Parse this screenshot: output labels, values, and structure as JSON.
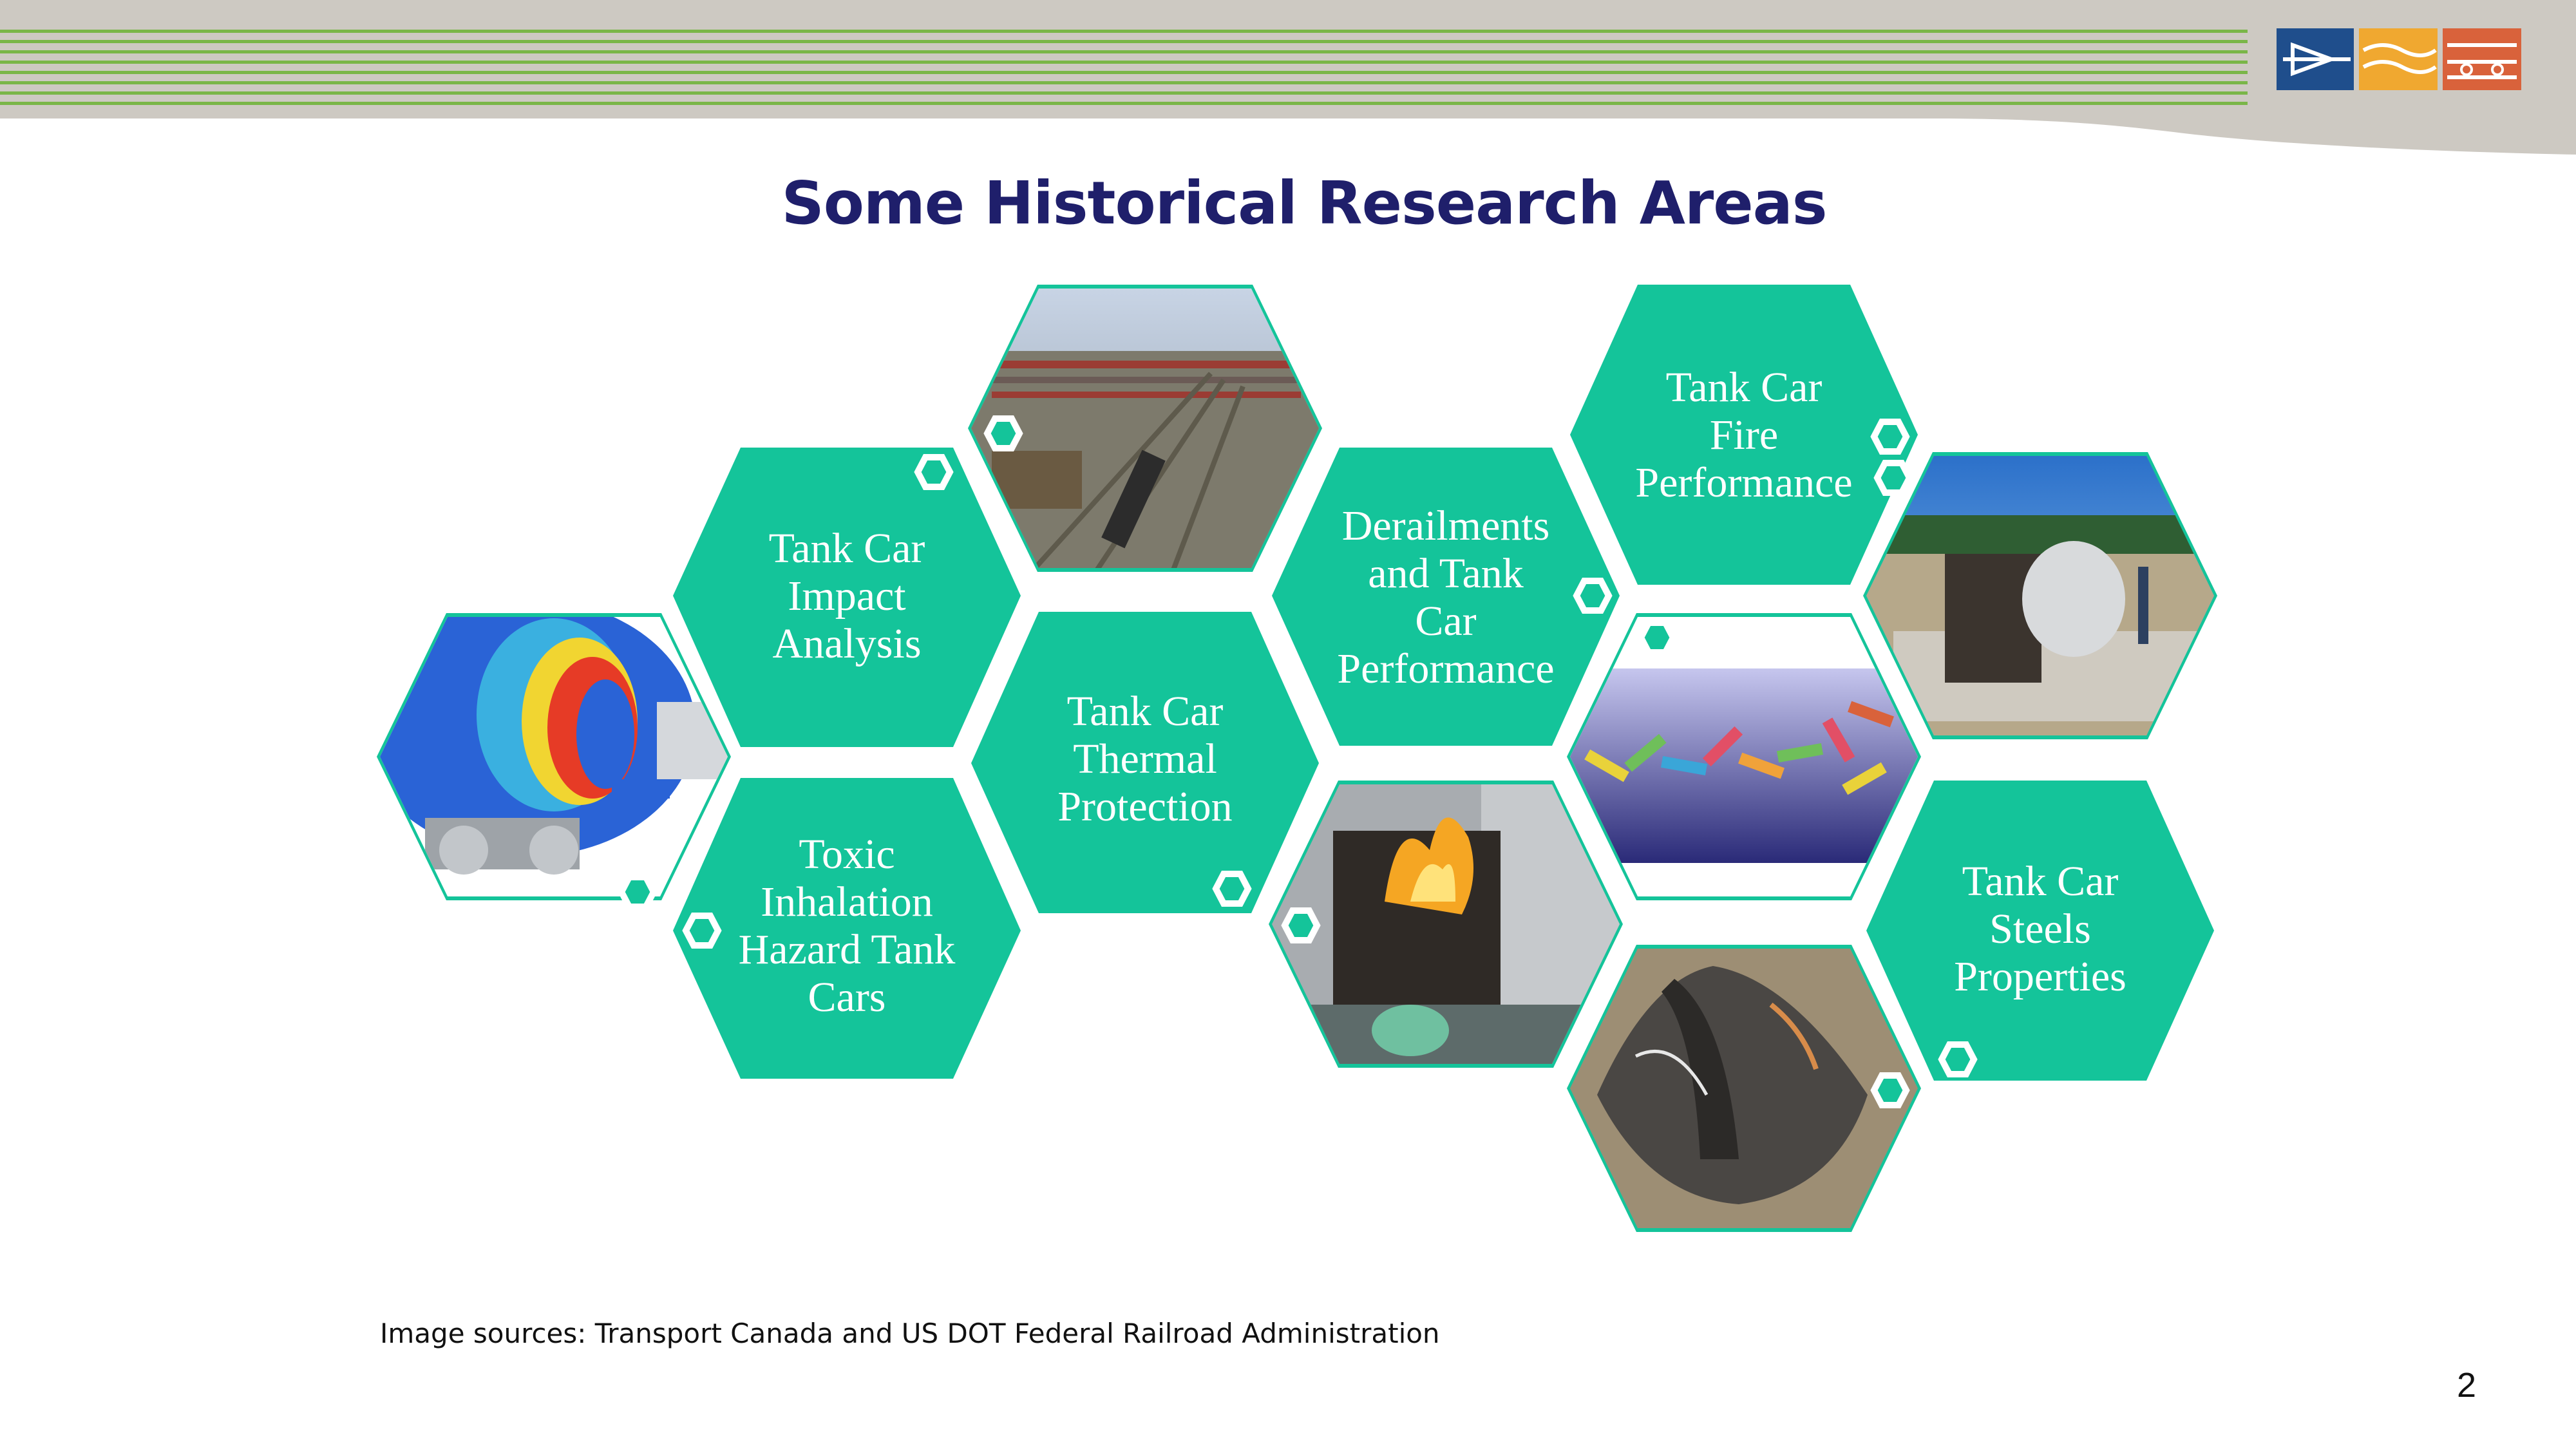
{
  "slide": {
    "title": "Some Historical Research Areas",
    "image_source_note": "Image sources: Transport Canada and US DOT Federal Railroad Administration",
    "page_number": "2"
  },
  "topics": [
    {
      "lines": [
        "Tank Car",
        "Impact",
        "Analysis"
      ]
    },
    {
      "lines": [
        "Toxic",
        "Inhalation",
        "Hazard Tank",
        "Cars"
      ]
    },
    {
      "lines": [
        "Tank Car",
        "Thermal",
        "Protection"
      ]
    },
    {
      "lines": [
        "Derailments",
        "and Tank",
        "Car",
        "Performance"
      ]
    },
    {
      "lines": [
        "Tank Car",
        "Fire",
        "Performance"
      ]
    },
    {
      "lines": [
        "Tank Car",
        "Steels",
        "Properties"
      ]
    }
  ],
  "colors": {
    "hex_fill": "#14c49a",
    "title": "#1f1f6b",
    "header_band": "#cdc9c2",
    "header_stripes": "#7ab648",
    "logo_blue": "#1f4e8c",
    "logo_gold": "#f0a830",
    "logo_orange": "#d9623b"
  }
}
